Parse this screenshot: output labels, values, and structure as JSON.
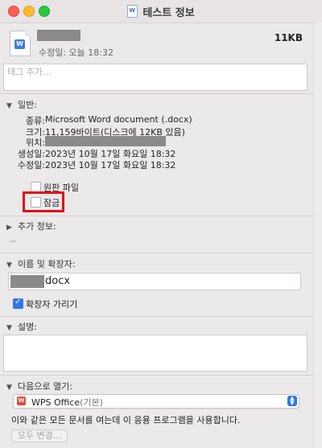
{
  "window": {
    "title": "테스트 정보"
  },
  "header": {
    "file_size": "11KB",
    "modified": "수정일: 오늘 18:32"
  },
  "tags": {
    "placeholder": "태그 추가..."
  },
  "general": {
    "heading": "일반:",
    "rows": [
      {
        "label": "종류:",
        "value": "Microsoft Word document (.docx)"
      },
      {
        "label": "크기:",
        "value": "11,159바이트(디스크에 12KB 있음)"
      },
      {
        "label": "위치:",
        "value": ""
      },
      {
        "label": "생성일:",
        "value": "2023년 10월 17일 화요일 18:32"
      },
      {
        "label": "수정일:",
        "value": "2023년 10월 17일 화요일 18:32"
      }
    ],
    "stationery_label": "원판 파일",
    "stationery_checked": false,
    "locked_label": "잠금",
    "locked_checked": false
  },
  "more_info": {
    "heading": "추가 정보:",
    "value": "--"
  },
  "name_ext": {
    "heading": "이름 및 확장자:",
    "extension": "docx",
    "hide_ext_label": "확장자 가리기",
    "hide_ext_checked": true
  },
  "comments": {
    "heading": "설명:"
  },
  "open_with": {
    "heading": "다음으로 열기:",
    "app_name": "WPS Office",
    "app_default": "(기본)",
    "note": "이와 같은 모든 문서를 여는데 이 응용 프로그램을 사용합니다.",
    "change_all_label": "모두 변경..."
  },
  "colors": {
    "highlight": "#e20d15",
    "accent": "#2f78e6"
  }
}
